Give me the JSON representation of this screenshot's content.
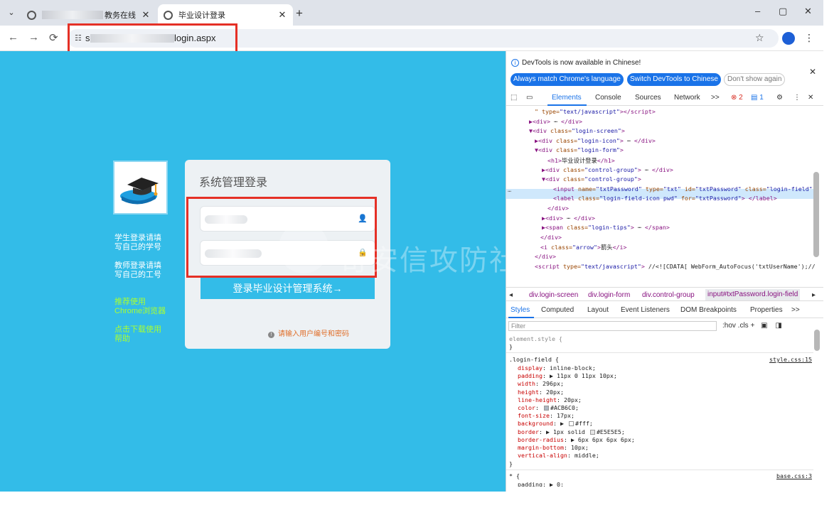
{
  "browser": {
    "tabs": [
      {
        "title": "教务在线",
        "active": false
      },
      {
        "title": "毕业设计登录",
        "active": true
      }
    ],
    "url_suffix": "login.aspx",
    "url_prefix": "s",
    "window_controls": [
      "–",
      "▢",
      "✕"
    ]
  },
  "page": {
    "login_title": "系统管理登录",
    "student_hint": [
      "学生登录请填",
      "写自己的学号"
    ],
    "teacher_hint": [
      "教师登录请填",
      "写自己的工号"
    ],
    "recommend": [
      "推荐使用",
      "Chrome浏览器"
    ],
    "help": [
      "点击下载使用",
      "帮助"
    ],
    "login_button": "登录毕业设计管理系统→",
    "tip": "请输入用户编号和密码",
    "watermark": "奇安信攻防社区"
  },
  "devtools": {
    "info": "DevTools is now available in Chinese!",
    "btn_match": "Always match Chrome's language",
    "btn_switch": "Switch DevTools to Chinese",
    "btn_dont": "Don't show again",
    "tabs": [
      "Elements",
      "Console",
      "Sources",
      "Network",
      ">>"
    ],
    "errors": "2",
    "messages": "1",
    "dom_lines": [
      {
        "html": "<span class='an'>\" type=</span><span class='av'>\"text/javascript\"</span>&gt;&lt;/script&gt;"
      },
      {
        "html": "▶&lt;div&gt; <span class='tx'>⋯</span> &lt;/div&gt;"
      },
      {
        "html": "▼&lt;div <span class='an'>class=</span><span class='av'>\"login-screen\"</span>&gt;"
      },
      {
        "html": "▶&lt;div <span class='an'>class=</span><span class='av'>\"login-icon\"</span>&gt; <span class='tx'>⋯</span> &lt;/div&gt;"
      },
      {
        "html": "▼&lt;div <span class='an'>class=</span><span class='av'>\"login-form\"</span>&gt;"
      },
      {
        "html": "&lt;h1&gt;<span class='tx'>毕业设计登录</span>&lt;/h1&gt;"
      },
      {
        "html": "▶&lt;div <span class='an'>class=</span><span class='av'>\"control-group\"</span>&gt; <span class='tx'>⋯</span> &lt;/div&gt;"
      },
      {
        "html": "▼&lt;div <span class='an'>class=</span><span class='av'>\"control-group\"</span>&gt;"
      },
      {
        "html": "&lt;input <span class='an'>name=</span><span class='av'>\"txtPassword\"</span> <span class='an'>type=</span><span class='av'>\"txt\"</span> <span class='an'>id=</span><span class='av'>\"txtPassword\"</span> <span class='an'>class=</span><span class='av'>\"login-field\"</span> p"
      },
      {
        "html": "&lt;label <span class='an'>class=</span><span class='av'>\"login-field-icon pwd\"</span> <span class='an'>for=</span><span class='av'>\"txtPassword\"</span>&gt; &lt;/label&gt;"
      },
      {
        "html": "&lt;/div&gt;"
      },
      {
        "html": "▶&lt;div&gt; <span class='tx'>⋯</span> &lt;/div&gt;"
      },
      {
        "html": "▶&lt;span <span class='an'>class=</span><span class='av'>\"login-tips\"</span>&gt; <span class='tx'>⋯</span> &lt;/span&gt;"
      },
      {
        "html": "&lt;/div&gt;"
      },
      {
        "html": "&lt;i <span class='an'>class=</span><span class='av'>\"arrow\"</span>&gt;<span class='tx'>箭头</span>&lt;/i&gt;"
      },
      {
        "html": "&lt;/div&gt;"
      },
      {
        "html": "&lt;script <span class='an'>type=</span><span class='av'>\"text/javascript\"</span>&gt; <span class='tx'>//&lt;![CDATA[ WebForm_AutoFocus('txtUserName');//]]</span>"
      }
    ],
    "crumbs": [
      "div.login-screen",
      "div.login-form",
      "div.control-group",
      "input#txtPassword.login-field"
    ],
    "pane_tabs": [
      "Styles",
      "Computed",
      "Layout",
      "Event Listeners",
      "DOM Breakpoints",
      "Properties",
      ">>"
    ],
    "filter_placeholder": "Filter",
    "filter_tools": ":hov  .cls  +",
    "element_style": "element.style {",
    "close_brace": "}",
    "rule_selector": ".login-field {",
    "rule_source": "style.css:15",
    "rule_props": [
      {
        "name": "display",
        "value": "inline-block;"
      },
      {
        "name": "padding",
        "value": "▶ 11px 0 11px 10px;"
      },
      {
        "name": "width",
        "value": "296px;"
      },
      {
        "name": "height",
        "value": "20px;"
      },
      {
        "name": "line-height",
        "value": "20px;"
      },
      {
        "name": "color",
        "value": "#ACB6C0;",
        "swatch": "#ACB6C0"
      },
      {
        "name": "font-size",
        "value": "17px;"
      },
      {
        "name": "background",
        "value": "▶ #fff;",
        "swatch": "#ffffff"
      },
      {
        "name": "border",
        "value": "▶ 1px solid #E5E5E5;",
        "swatch": "#E5E5E5"
      },
      {
        "name": "border-radius",
        "value": "▶ 6px 6px 6px 6px;"
      },
      {
        "name": "margin-bottom",
        "value": "10px;"
      },
      {
        "name": "vertical-align",
        "value": "middle;"
      }
    ],
    "universal_selector": "* {",
    "universal_source": "base.css:3",
    "universal_prop": "padding: ▶ 0;"
  }
}
